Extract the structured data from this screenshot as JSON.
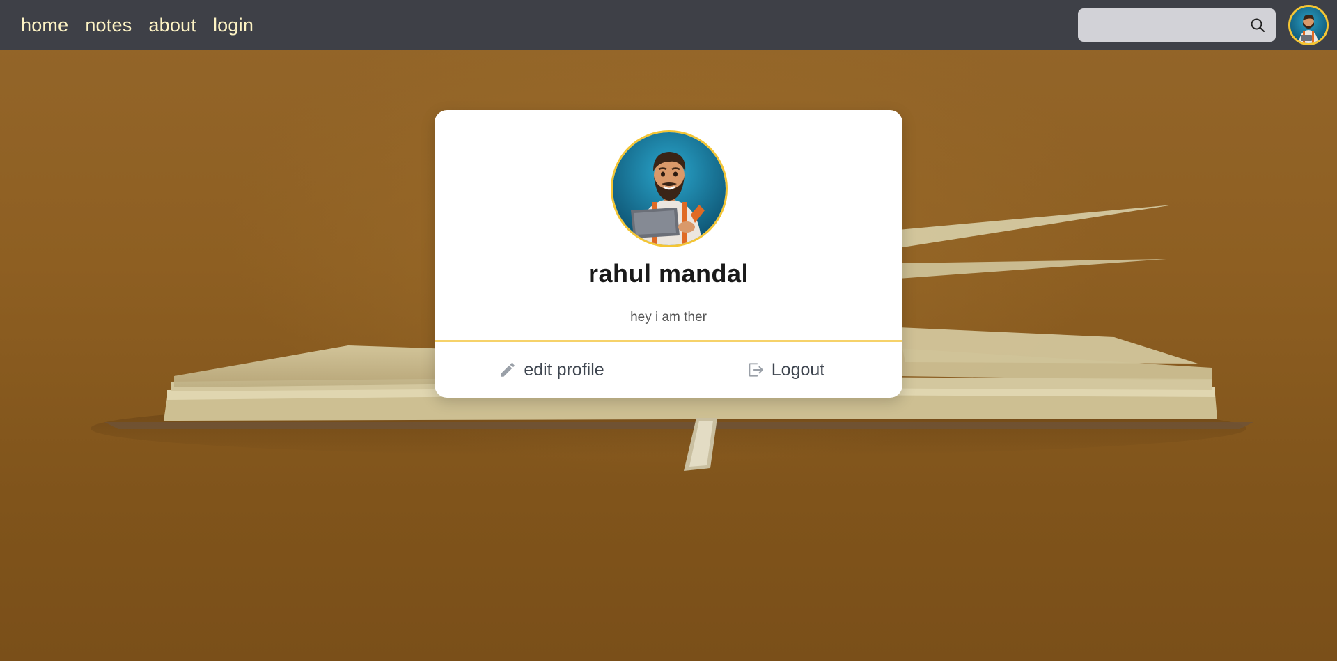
{
  "nav": {
    "links": [
      "home",
      "notes",
      "about",
      "login"
    ],
    "search_placeholder": ""
  },
  "profile": {
    "name": "rahul mandal",
    "bio": "hey i am ther",
    "edit_label": "edit profile",
    "logout_label": "Logout"
  },
  "colors": {
    "navbar": "#3e4047",
    "nav_text": "#fdf3c4",
    "accent": "#f4c534",
    "search_bg": "#d2d2d7"
  },
  "icons": {
    "search": "search-icon",
    "edit": "pencil-icon",
    "logout": "logout-icon"
  }
}
